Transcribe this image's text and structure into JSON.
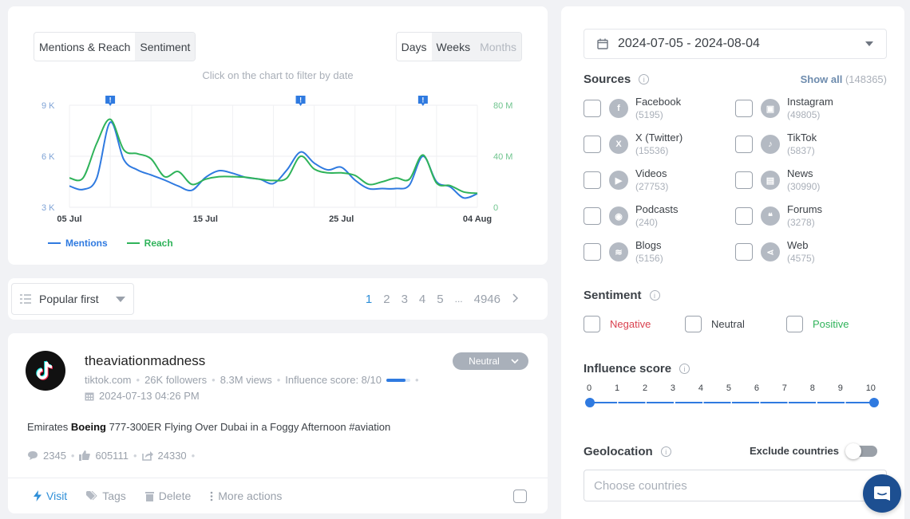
{
  "chart_card": {
    "tabs": [
      {
        "label": "Mentions & Reach",
        "active": true
      },
      {
        "label": "Sentiment",
        "active": false
      }
    ],
    "period_tabs": [
      {
        "label": "Days",
        "state": "active"
      },
      {
        "label": "Weeks",
        "state": "inactive"
      },
      {
        "label": "Months",
        "state": "disabled"
      }
    ],
    "hint": "Click on the chart to filter by date"
  },
  "chart_data": {
    "type": "line",
    "title": "",
    "x": [
      "05 Jul",
      "06 Jul",
      "07 Jul",
      "08 Jul",
      "09 Jul",
      "10 Jul",
      "11 Jul",
      "12 Jul",
      "13 Jul",
      "14 Jul",
      "15 Jul",
      "16 Jul",
      "17 Jul",
      "18 Jul",
      "19 Jul",
      "20 Jul",
      "21 Jul",
      "22 Jul",
      "23 Jul",
      "24 Jul",
      "25 Jul",
      "26 Jul",
      "27 Jul",
      "28 Jul",
      "29 Jul",
      "30 Jul",
      "31 Jul",
      "01 Aug",
      "02 Aug",
      "03 Aug",
      "04 Aug"
    ],
    "x_tick_labels": [
      "05 Jul",
      "15 Jul",
      "25 Jul",
      "04 Aug"
    ],
    "y_left": {
      "label": "Mentions",
      "ticks": [
        "3 K",
        "6 K",
        "9 K"
      ],
      "range": [
        3000,
        9000
      ]
    },
    "y_right": {
      "label": "Reach",
      "ticks": [
        "0",
        "40 M",
        "80 M"
      ],
      "range": [
        0,
        80000000
      ]
    },
    "series": [
      {
        "name": "Mentions",
        "axis": "left",
        "color": "#2f7ae0",
        "values": [
          4250,
          4050,
          4700,
          8000,
          5800,
          5200,
          4900,
          4600,
          4250,
          4000,
          4750,
          5150,
          5000,
          4750,
          4650,
          4400,
          5200,
          6250,
          5600,
          5200,
          5350,
          4600,
          4100,
          4100,
          4100,
          4300,
          6000,
          4500,
          4200,
          3550,
          3800
        ]
      },
      {
        "name": "Reach",
        "axis": "right",
        "color": "#2fb35a",
        "values": [
          23000000,
          23000000,
          50000000,
          69000000,
          45000000,
          42000000,
          38000000,
          24000000,
          28000000,
          18000000,
          22000000,
          24000000,
          24000000,
          23500000,
          22000000,
          21000000,
          23000000,
          40000000,
          30000000,
          27000000,
          27000000,
          25000000,
          18000000,
          20000000,
          23000000,
          22000000,
          41000000,
          19000000,
          17000000,
          12000000,
          11000000
        ]
      }
    ],
    "annotations": [
      {
        "x": "08 Jul",
        "label": "!"
      },
      {
        "x": "22 Jul",
        "label": "!"
      },
      {
        "x": "31 Jul",
        "label": "!"
      }
    ],
    "grid": true,
    "legend": "bottom-left"
  },
  "sort": {
    "label": "Popular first"
  },
  "pagination": {
    "pages": [
      "1",
      "2",
      "3",
      "4",
      "5"
    ],
    "ellipsis": "...",
    "last": "4946",
    "current": "1"
  },
  "post": {
    "author": "theaviationmadness",
    "source": "tiktok.com",
    "followers": "26K followers",
    "views": "8.3M views",
    "influence": "Influence score: 8/10",
    "influence_value": 0.8,
    "date": "2024-07-13 04:26 PM",
    "sentiment": "Neutral",
    "text_before": "Emirates ",
    "text_bold": "Boeing",
    "text_after": " 777-300ER Flying Over Dubai in a Foggy Afternoon #aviation",
    "comments": "2345",
    "likes": "605111",
    "shares": "24330",
    "actions": {
      "visit": "Visit",
      "tags": "Tags",
      "delete": "Delete",
      "more": "More actions"
    }
  },
  "filters": {
    "date_range": "2024-07-05 - 2024-08-04",
    "sources_title": "Sources",
    "show_all": "Show all",
    "show_all_count": "(148365)",
    "sources": [
      {
        "name": "Facebook",
        "count": "(5195)",
        "icon": "f"
      },
      {
        "name": "Instagram",
        "count": "(49805)",
        "icon": "▣"
      },
      {
        "name": "X (Twitter)",
        "count": "(15536)",
        "icon": "X"
      },
      {
        "name": "TikTok",
        "count": "(5837)",
        "icon": "♪"
      },
      {
        "name": "Videos",
        "count": "(27753)",
        "icon": "▶"
      },
      {
        "name": "News",
        "count": "(30990)",
        "icon": "▤"
      },
      {
        "name": "Podcasts",
        "count": "(240)",
        "icon": "◉"
      },
      {
        "name": "Forums",
        "count": "(3278)",
        "icon": "❝"
      },
      {
        "name": "Blogs",
        "count": "(5156)",
        "icon": "≋"
      },
      {
        "name": "Web",
        "count": "(4575)",
        "icon": "⋖"
      }
    ],
    "sentiment_title": "Sentiment",
    "sentiments": [
      {
        "label": "Negative",
        "color": "#d9414f"
      },
      {
        "label": "Neutral",
        "color": "#3c4147"
      },
      {
        "label": "Positive",
        "color": "#2fb35a"
      }
    ],
    "influence_title": "Influence score",
    "influence_ticks": [
      "0",
      "1",
      "2",
      "3",
      "4",
      "5",
      "6",
      "7",
      "8",
      "9",
      "10"
    ],
    "influence_range": [
      0,
      10
    ],
    "geolocation_title": "Geolocation",
    "exclude_countries": "Exclude countries",
    "exclude_enabled": false,
    "countries_placeholder": "Choose countries"
  }
}
